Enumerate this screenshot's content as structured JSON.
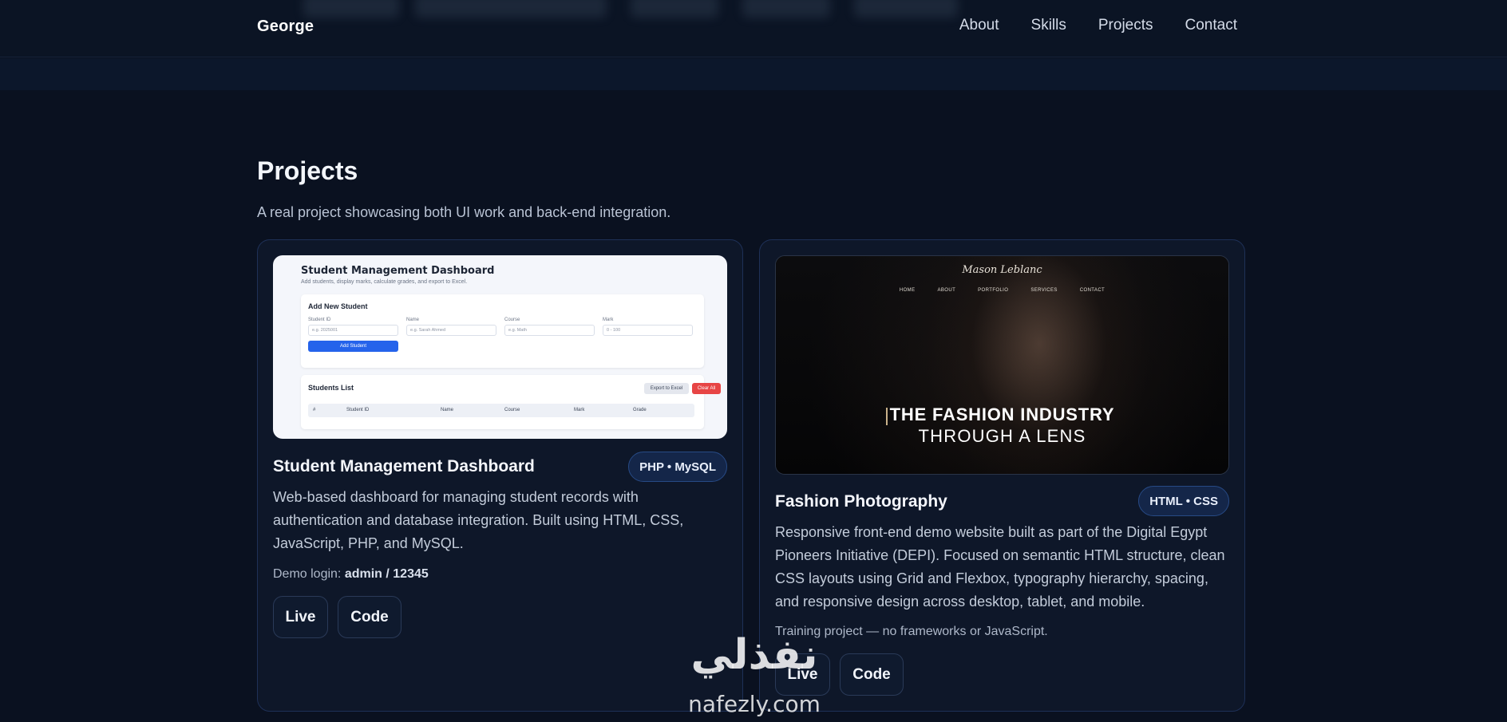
{
  "header": {
    "brand": "George",
    "nav": [
      "About",
      "Skills",
      "Projects",
      "Contact"
    ]
  },
  "projects": {
    "title": "Projects",
    "subtitle": "A real project showcasing both UI work and back-end integration.",
    "cards": [
      {
        "title": "Student Management Dashboard",
        "badge": "PHP • MySQL",
        "description": "Web-based dashboard for managing student records with authentication and database integration. Built using HTML, CSS, JavaScript, PHP, and MySQL.",
        "note_prefix": "Demo login: ",
        "note_bold": "admin / 12345",
        "live_label": "Live",
        "code_label": "Code",
        "preview": {
          "title": "Student Management Dashboard",
          "subtitle": "Add students, display marks, calculate grades, and export to Excel.",
          "form_title": "Add New Student",
          "fields": [
            {
              "label": "Student ID",
              "placeholder": "e.g. 2025001"
            },
            {
              "label": "Name",
              "placeholder": "e.g. Sarah Ahmed"
            },
            {
              "label": "Course",
              "placeholder": "e.g. Math"
            },
            {
              "label": "Mark",
              "placeholder": "0 - 100"
            }
          ],
          "add_button": "Add Student",
          "list_title": "Students List",
          "export_button": "Export to Excel",
          "clear_button": "Clear All",
          "columns": [
            "#",
            "Student ID",
            "Name",
            "Course",
            "Mark",
            "Grade"
          ]
        }
      },
      {
        "title": "Fashion Photography",
        "badge": "HTML • CSS",
        "description": "Responsive front-end demo website built as part of the Digital Egypt Pioneers Initiative (DEPI). Focused on semantic HTML structure, clean CSS layouts using Grid and Flexbox, typography hierarchy, spacing, and responsive design across desktop, tablet, and mobile.",
        "note": "Training project — no frameworks or JavaScript.",
        "live_label": "Live",
        "code_label": "Code",
        "preview": {
          "logo": "Mason Leblanc",
          "nav": [
            "HOME",
            "ABOUT",
            "PORTFOLIO",
            "SERVICES",
            "CONTACT"
          ],
          "headline_1": "THE FASHION INDUSTRY",
          "headline_2": "THROUGH A LENS"
        }
      }
    ]
  },
  "watermark": {
    "arabic": "نفذلي",
    "latin": "nafezly.com"
  },
  "colors": {
    "background": "#0a1120",
    "card": "#0e1729",
    "card_border": "#1e3057",
    "badge": "#142649",
    "danger": "#e74545",
    "primary": "#2563eb"
  }
}
